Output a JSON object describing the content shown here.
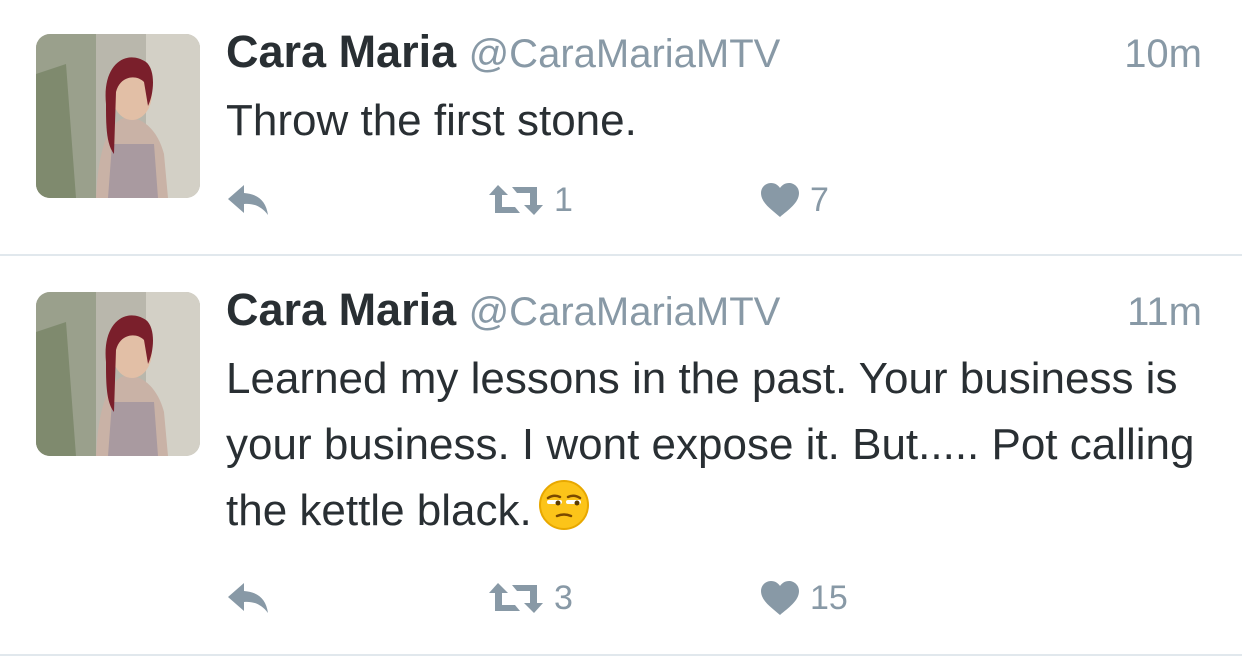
{
  "colors": {
    "text": "#292f33",
    "secondary": "#8899a6",
    "divider": "#e1e8ed",
    "background": "#ffffff"
  },
  "tweets": [
    {
      "name": "Cara Maria",
      "handle": "@CaraMariaMTV",
      "time": "10m",
      "text": "Throw the first stone.",
      "emoji": "",
      "retweets": "1",
      "likes": "7",
      "icons": [
        "reply-icon",
        "retweet-icon",
        "heart-icon"
      ]
    },
    {
      "name": "Cara Maria",
      "handle": "@CaraMariaMTV",
      "time": "11m",
      "text": "Learned my lessons in the past. Your business is your business. I wont expose it.  But..... Pot calling the kettle black.",
      "emoji": "unamused-face-emoji",
      "retweets": "3",
      "likes": "15",
      "icons": [
        "reply-icon",
        "retweet-icon",
        "heart-icon"
      ]
    }
  ]
}
